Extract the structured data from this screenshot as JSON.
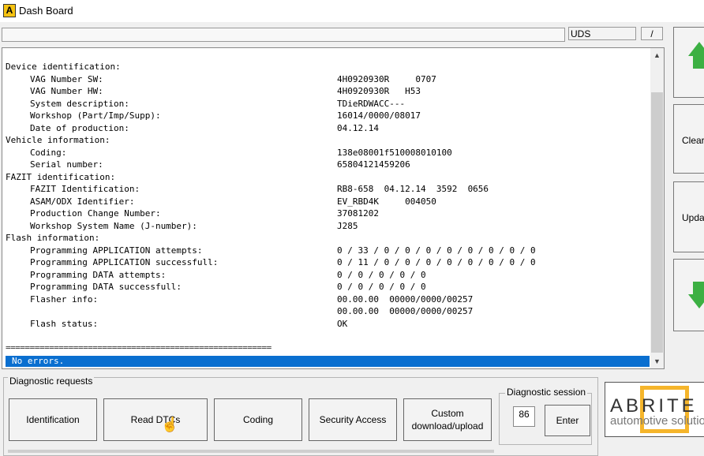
{
  "window": {
    "icon_letter": "A",
    "title": "Dash Board"
  },
  "top": {
    "protocol": "UDS",
    "slash": "/"
  },
  "output": {
    "lines": [
      {
        "indent": 0,
        "label": "Device identification:",
        "value": ""
      },
      {
        "indent": 1,
        "label": "VAG Number SW:",
        "value": "4H0920930R     0707"
      },
      {
        "indent": 1,
        "label": "VAG Number HW:",
        "value": "4H0920930R   H53"
      },
      {
        "indent": 1,
        "label": "System description:",
        "value": "TDieRDWACC---"
      },
      {
        "indent": 1,
        "label": "Workshop (Part/Imp/Supp):",
        "value": "16014/0000/08017"
      },
      {
        "indent": 1,
        "label": "Date of production:",
        "value": "04.12.14"
      },
      {
        "indent": 0,
        "label": "Vehicle information:",
        "value": ""
      },
      {
        "indent": 1,
        "label": "Coding:",
        "value": "138e08001f510008010100"
      },
      {
        "indent": 1,
        "label": "Serial number:",
        "value": "65804121459206"
      },
      {
        "indent": 0,
        "label": "FAZIT identification:",
        "value": ""
      },
      {
        "indent": 1,
        "label": "FAZIT Identification:",
        "value": "RB8-658  04.12.14  3592  0656"
      },
      {
        "indent": 1,
        "label": "ASAM/ODX Identifier:",
        "value": "EV_RBD4K     004050"
      },
      {
        "indent": 1,
        "label": "Production Change Number:",
        "value": "37081202"
      },
      {
        "indent": 1,
        "label": "Workshop System Name (J-number):",
        "value": "J285"
      },
      {
        "indent": 0,
        "label": "Flash information:",
        "value": ""
      },
      {
        "indent": 1,
        "label": "Programming APPLICATION attempts:",
        "value": "0 / 33 / 0 / 0 / 0 / 0 / 0 / 0 / 0 / 0"
      },
      {
        "indent": 1,
        "label": "Programming APPLICATION successfull:",
        "value": "0 / 11 / 0 / 0 / 0 / 0 / 0 / 0 / 0 / 0"
      },
      {
        "indent": 1,
        "label": "Programming DATA attempts:",
        "value": "0 / 0 / 0 / 0 / 0"
      },
      {
        "indent": 1,
        "label": "Programming DATA successfull:",
        "value": "0 / 0 / 0 / 0 / 0"
      },
      {
        "indent": 1,
        "label": "Flasher info:",
        "value": "00.00.00  00000/0000/00257"
      },
      {
        "indent": 1,
        "label": "",
        "value": "00.00.00  00000/0000/00257"
      },
      {
        "indent": 1,
        "label": "Flash status:",
        "value": "OK"
      }
    ],
    "divider": "=======================================================",
    "status": "No errors."
  },
  "right_buttons": {
    "clear": "Clear",
    "update": "Updat"
  },
  "diagnostic_requests": {
    "label": "Diagnostic requests",
    "buttons": [
      "Identification",
      "Read DTCs",
      "Coding",
      "Security Access",
      "Custom download/upload"
    ]
  },
  "diagnostic_session": {
    "label": "Diagnostic session",
    "value": "86",
    "enter": "Enter"
  },
  "logo": {
    "text": "ABRITE",
    "subtext": "automotive solutions"
  },
  "colors": {
    "status_bar": "#0a6fd0",
    "arrow": "#3cb043",
    "logo_accent": "#f5b52b"
  }
}
